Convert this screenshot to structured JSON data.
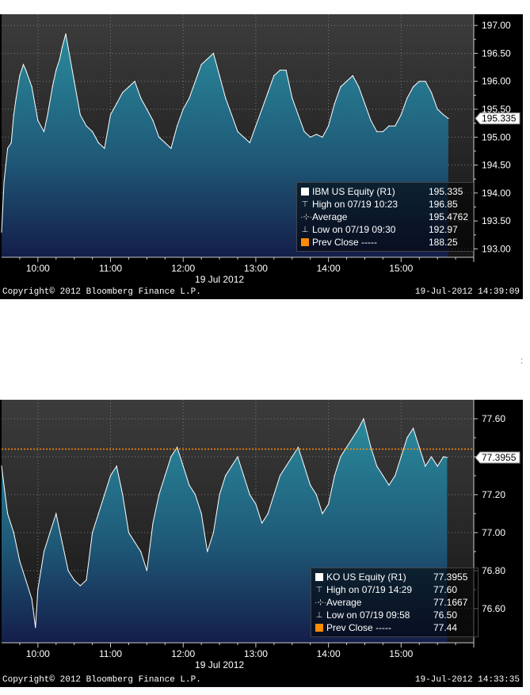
{
  "chart_data": [
    {
      "type": "area",
      "ticker": "IBM US Equity",
      "date_label": "19 Jul 2012",
      "x_ticks": [
        "10:00",
        "11:00",
        "12:00",
        "13:00",
        "14:00",
        "15:00"
      ],
      "y_ticks": [
        "193.00",
        "193.50",
        "194.00",
        "194.50",
        "195.00",
        "195.50",
        "196.00",
        "196.50",
        "197.00"
      ],
      "ylim": [
        192.85,
        197.2
      ],
      "x_range": [
        "09:30",
        "16:00"
      ],
      "last_value_label": "195.335",
      "series": [
        {
          "name": "IBM US Equity (R1)",
          "x": [
            "09:30",
            "09:32",
            "09:35",
            "09:38",
            "09:40",
            "09:42",
            "09:45",
            "09:48",
            "09:50",
            "09:55",
            "10:00",
            "10:05",
            "10:08",
            "10:12",
            "10:15",
            "10:18",
            "10:20",
            "10:23",
            "10:25",
            "10:30",
            "10:35",
            "10:40",
            "10:45",
            "10:50",
            "10:55",
            "11:00",
            "11:05",
            "11:10",
            "11:15",
            "11:20",
            "11:25",
            "11:30",
            "11:35",
            "11:40",
            "11:45",
            "11:50",
            "11:55",
            "12:00",
            "12:05",
            "12:10",
            "12:15",
            "12:20",
            "12:25",
            "12:30",
            "12:35",
            "12:40",
            "12:45",
            "12:50",
            "12:55",
            "13:00",
            "13:05",
            "13:10",
            "13:15",
            "13:20",
            "13:25",
            "13:30",
            "13:35",
            "13:40",
            "13:45",
            "13:50",
            "13:55",
            "14:00",
            "14:05",
            "14:10",
            "14:15",
            "14:20",
            "14:25",
            "14:30",
            "14:35",
            "14:40",
            "14:45",
            "14:50",
            "14:55",
            "15:00",
            "15:05",
            "15:10",
            "15:15",
            "15:20",
            "15:25",
            "15:30",
            "15:35",
            "15:39"
          ],
          "values": [
            193.3,
            194.2,
            194.8,
            194.9,
            195.4,
            195.7,
            196.1,
            196.3,
            196.2,
            195.9,
            195.3,
            195.1,
            195.4,
            195.9,
            196.2,
            196.4,
            196.6,
            196.85,
            196.6,
            196.0,
            195.4,
            195.2,
            195.1,
            194.9,
            194.8,
            195.4,
            195.6,
            195.8,
            195.9,
            196.0,
            195.7,
            195.5,
            195.3,
            195.0,
            194.9,
            194.8,
            195.2,
            195.5,
            195.7,
            196.0,
            196.3,
            196.4,
            196.5,
            196.1,
            195.7,
            195.4,
            195.1,
            195.0,
            194.9,
            195.2,
            195.5,
            195.8,
            196.1,
            196.2,
            196.2,
            195.7,
            195.4,
            195.1,
            195.0,
            195.05,
            195.0,
            195.2,
            195.6,
            195.9,
            196.0,
            196.1,
            195.9,
            195.6,
            195.3,
            195.1,
            195.1,
            195.2,
            195.2,
            195.4,
            195.7,
            195.9,
            196.0,
            196.0,
            195.8,
            195.5,
            195.4,
            195.335
          ]
        }
      ],
      "legend": [
        {
          "label": "IBM US Equity (R1)",
          "value": "195.335",
          "symbol": "square-white"
        },
        {
          "label": "High on 07/19 10:23",
          "value": "196.85",
          "symbol": "high"
        },
        {
          "label": "Average",
          "value": "195.4762",
          "symbol": "avg"
        },
        {
          "label": "Low on 07/19 09:30",
          "value": "192.97",
          "symbol": "low"
        },
        {
          "label": "Prev Close -----",
          "value": "188.25",
          "symbol": "square-orange"
        }
      ],
      "copyright": "Copyright© 2012 Bloomberg Finance L.P.",
      "timestamp": "19-Jul-2012 14:39:09",
      "grid": true
    },
    {
      "type": "area",
      "ticker": "KO US Equity",
      "date_label": "19 Jul 2012",
      "x_ticks": [
        "10:00",
        "11:00",
        "12:00",
        "13:00",
        "14:00",
        "15:00"
      ],
      "y_ticks": [
        "76.60",
        "76.80",
        "77.00",
        "77.20",
        "77.40",
        "77.60"
      ],
      "ylim": [
        76.42,
        77.7
      ],
      "x_range": [
        "09:30",
        "16:00"
      ],
      "last_value_label": "77.3955",
      "prev_close": 77.44,
      "series": [
        {
          "name": "KO US Equity (R1)",
          "x": [
            "09:30",
            "09:35",
            "09:40",
            "09:45",
            "09:50",
            "09:55",
            "09:58",
            "10:00",
            "10:05",
            "10:10",
            "10:15",
            "10:20",
            "10:25",
            "10:30",
            "10:35",
            "10:40",
            "10:45",
            "10:50",
            "10:55",
            "11:00",
            "11:05",
            "11:10",
            "11:15",
            "11:20",
            "11:25",
            "11:30",
            "11:35",
            "11:40",
            "11:45",
            "11:50",
            "11:55",
            "12:00",
            "12:05",
            "12:10",
            "12:15",
            "12:20",
            "12:25",
            "12:30",
            "12:35",
            "12:40",
            "12:45",
            "12:50",
            "12:55",
            "13:00",
            "13:05",
            "13:10",
            "13:15",
            "13:20",
            "13:25",
            "13:30",
            "13:35",
            "13:40",
            "13:45",
            "13:50",
            "13:55",
            "14:00",
            "14:05",
            "14:10",
            "14:15",
            "14:20",
            "14:25",
            "14:29",
            "14:35",
            "14:40",
            "14:45",
            "14:50",
            "14:55",
            "15:00",
            "15:05",
            "15:10",
            "15:15",
            "15:20",
            "15:25",
            "15:30",
            "15:35",
            "15:38"
          ],
          "values": [
            77.35,
            77.1,
            77.0,
            76.85,
            76.75,
            76.65,
            76.5,
            76.7,
            76.9,
            77.0,
            77.1,
            76.95,
            76.8,
            76.75,
            76.72,
            76.75,
            77.0,
            77.1,
            77.2,
            77.3,
            77.35,
            77.2,
            77.0,
            76.95,
            76.9,
            76.8,
            77.05,
            77.2,
            77.3,
            77.4,
            77.45,
            77.35,
            77.25,
            77.2,
            77.1,
            76.9,
            77.0,
            77.2,
            77.3,
            77.35,
            77.4,
            77.3,
            77.2,
            77.15,
            77.05,
            77.1,
            77.2,
            77.3,
            77.35,
            77.4,
            77.45,
            77.35,
            77.25,
            77.2,
            77.1,
            77.15,
            77.3,
            77.4,
            77.45,
            77.5,
            77.55,
            77.6,
            77.45,
            77.35,
            77.3,
            77.25,
            77.3,
            77.4,
            77.5,
            77.55,
            77.45,
            77.35,
            77.4,
            77.35,
            77.4,
            77.3955
          ]
        }
      ],
      "legend": [
        {
          "label": "KO US Equity (R1)",
          "value": "77.3955",
          "symbol": "square-white"
        },
        {
          "label": "High on 07/19 14:29",
          "value": "77.60",
          "symbol": "high"
        },
        {
          "label": "Average",
          "value": "77.1667",
          "symbol": "avg"
        },
        {
          "label": "Low on 07/19 09:58",
          "value": "76.50",
          "symbol": "low"
        },
        {
          "label": "Prev Close -----",
          "value": "77.44",
          "symbol": "square-orange"
        }
      ],
      "copyright": "Copyright© 2012 Bloomberg Finance L.P.",
      "timestamp": "19-Jul-2012 14:33:35",
      "grid": true
    }
  ],
  "colors": {
    "fill_top": "#2a8a9c",
    "fill_bottom": "#141e4a",
    "line": "#ffffff",
    "background_top": "#3c3c3c",
    "background_bottom": "#151515",
    "prev_close": "#ff8c00",
    "grid": "#7a7a7a"
  },
  "stray_mark": ":"
}
